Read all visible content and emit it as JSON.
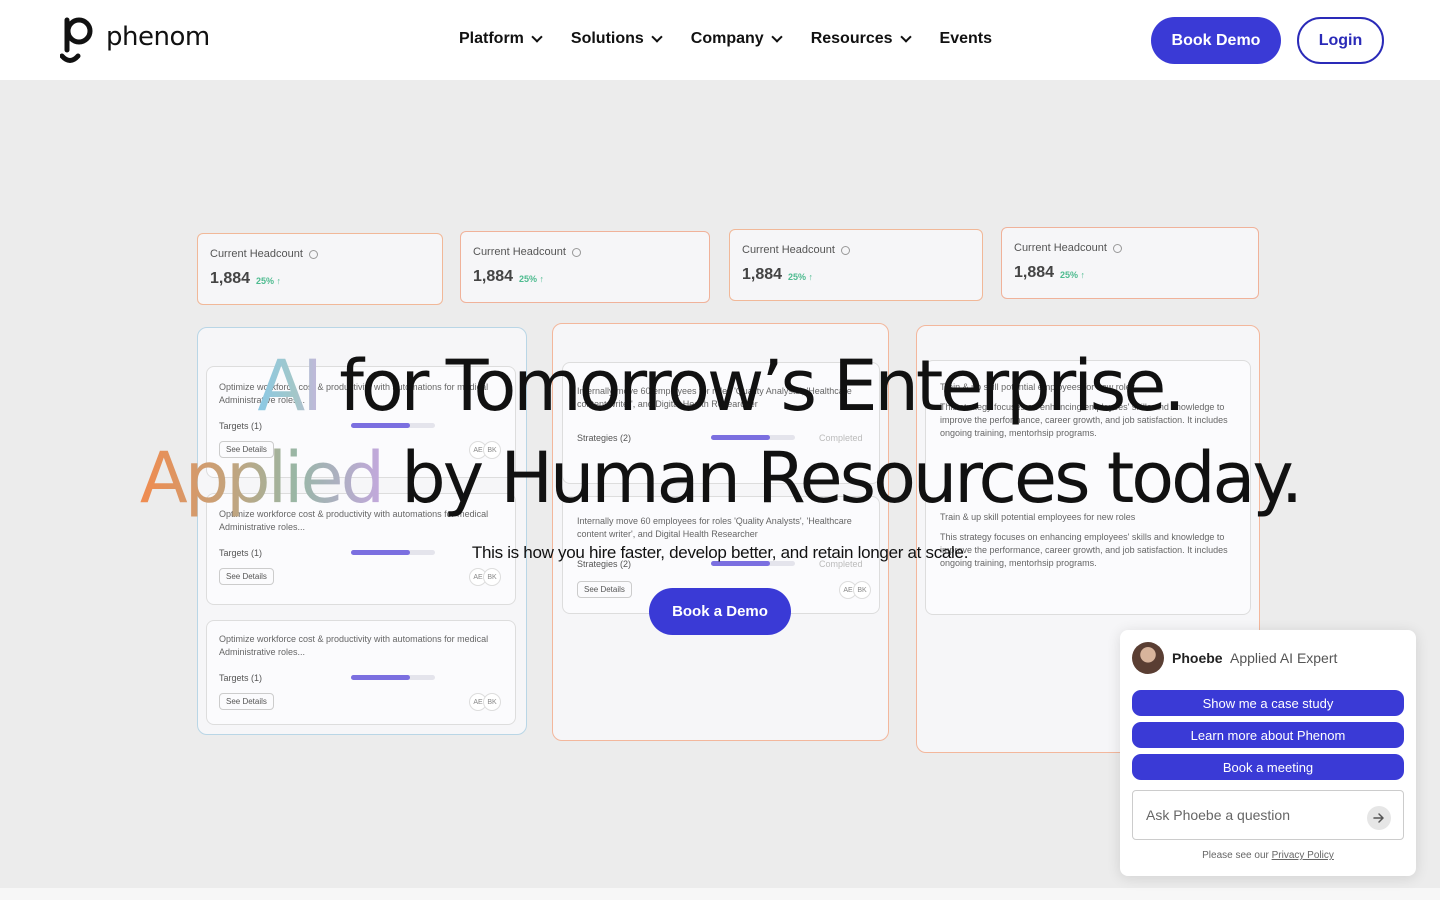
{
  "nav": {
    "logo_text": "phenom",
    "menu": [
      {
        "label": "Platform",
        "has_dropdown": true
      },
      {
        "label": "Solutions",
        "has_dropdown": true
      },
      {
        "label": "Company",
        "has_dropdown": true
      },
      {
        "label": "Resources",
        "has_dropdown": true
      },
      {
        "label": "Events",
        "has_dropdown": false
      }
    ],
    "book_demo": "Book Demo",
    "login": "Login"
  },
  "background_cards": {
    "headcount_label": "Current Headcount",
    "headcount_value": "1,884",
    "headcount_change": "25% ↑",
    "optimize_text": "Optimize workforce cost & productivity with automations for medical Administrative roles...",
    "targets": "Targets (1)",
    "strategies": "Strategies (2)",
    "completed": "Completed",
    "see_details": "See Details",
    "avatar_a": "AE",
    "avatar_b": "BK",
    "move_text": "Internally move 60 employees for roles 'Quality Analysts', 'Healthcare content writer', and Digital Health Researcher",
    "train_title": "Train & up skill potential employees for new roles",
    "train_text": "This strategy focuses on enhancing employees' skills and knowledge to improve the performance, career growth, and job satisfaction. It includes ongoing training, mentorhsip programs."
  },
  "hero": {
    "line1_accent": "AI",
    "line1_rest": " for Tomorrow’s Enterprise.",
    "line2_accent": "Applied",
    "line2_rest": " by Human Resources today.",
    "subline": "This is how you hire faster, develop better, and retain longer at scale.",
    "cta": "Book a Demo"
  },
  "chat": {
    "name": "Phoebe",
    "role": "Applied AI Expert",
    "options": [
      "Show me a case study",
      "Learn more about Phenom",
      "Book a meeting"
    ],
    "input_placeholder": "Ask Phoebe a question",
    "footer_prefix": "Please see our ",
    "footer_link": "Privacy Policy"
  },
  "colors": {
    "brand": "#3a3ad6",
    "login_border": "#2a2ab8"
  }
}
